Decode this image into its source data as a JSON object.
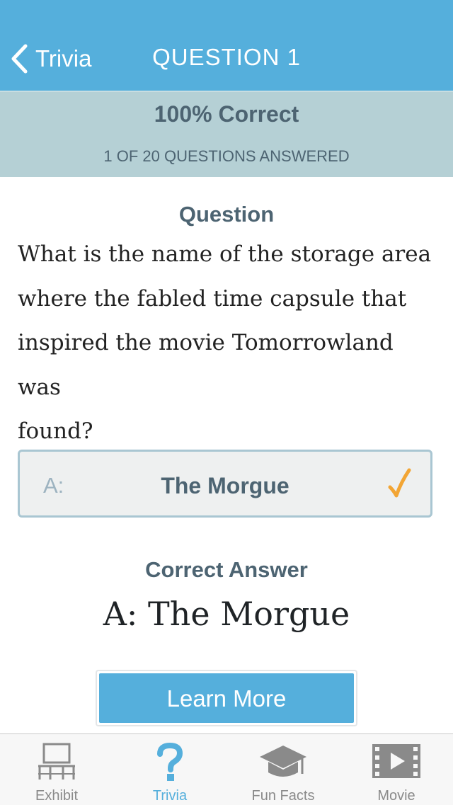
{
  "navbar": {
    "back_label": "Trivia",
    "title": "QUESTION 1",
    "background": "#55afdc"
  },
  "score": {
    "percent_label": "100% Correct",
    "answered_label": "1 OF 20 QUESTIONS ANSWERED"
  },
  "question": {
    "heading": "Question",
    "lines": [
      "What is the name of the storage area",
      "where the fabled time capsule that",
      "inspired the movie Tomorrowland was",
      "found?"
    ]
  },
  "answer_option": {
    "prefix": "A:",
    "text": "The Morgue",
    "status_icon": "checkmark-icon",
    "check_color": "#f2a534"
  },
  "correct_answer": {
    "heading": "Correct Answer",
    "value": "A: The Morgue"
  },
  "learn_more": {
    "label": "Learn More"
  },
  "tabbar": {
    "active_color": "#55afdc",
    "inactive_color": "#8a8a8a",
    "items": [
      {
        "label": "Exhibit",
        "icon": "exhibit-icon",
        "active": false
      },
      {
        "label": "Trivia",
        "icon": "question-mark-icon",
        "active": true
      },
      {
        "label": "Fun Facts",
        "icon": "graduation-cap-icon",
        "active": false
      },
      {
        "label": "Movie",
        "icon": "film-icon",
        "active": false
      }
    ]
  }
}
